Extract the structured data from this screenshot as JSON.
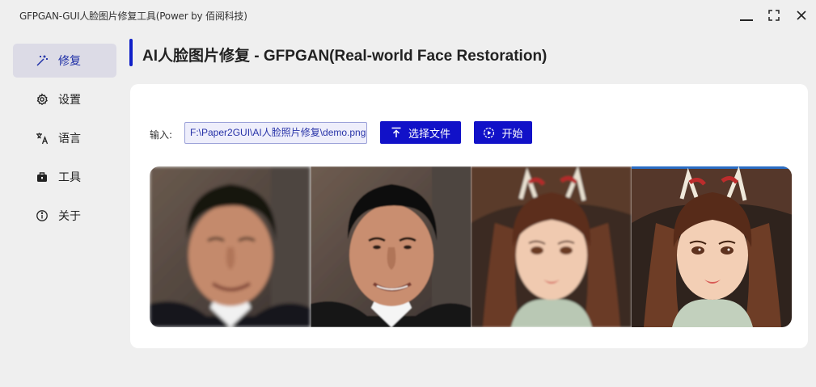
{
  "window": {
    "title": "GFPGAN-GUI人脸图片修复工具(Power by 佰阅科技)",
    "controls": [
      "minimize-icon",
      "maximize-icon",
      "close-icon"
    ]
  },
  "sidebar": {
    "items": [
      {
        "label": "修复",
        "icon": "magic-wand-icon",
        "active": true
      },
      {
        "label": "设置",
        "icon": "gear-icon",
        "active": false
      },
      {
        "label": "语言",
        "icon": "translate-icon",
        "active": false
      },
      {
        "label": "工具",
        "icon": "toolbox-icon",
        "active": false
      },
      {
        "label": "关于",
        "icon": "info-icon",
        "active": false
      }
    ]
  },
  "header": {
    "title": "AI人脸图片修复 - GFPGAN(Real-world Face Restoration)"
  },
  "main": {
    "input_label": "输入:",
    "input_path": "F:\\Paper2GUI\\AI人脸照片修复\\demo.png",
    "select_button": "选择文件",
    "start_button": "开始",
    "images": [
      {
        "subject": "man-original"
      },
      {
        "subject": "man-restored"
      },
      {
        "subject": "illustrated-woman-original"
      },
      {
        "subject": "illustrated-woman-restored"
      }
    ]
  },
  "colors": {
    "accent": "#1020c8",
    "button": "#1111c8",
    "active_nav_bg": "#dcdbe6",
    "card_bg": "#ffffff",
    "window_bg": "#efefef"
  }
}
